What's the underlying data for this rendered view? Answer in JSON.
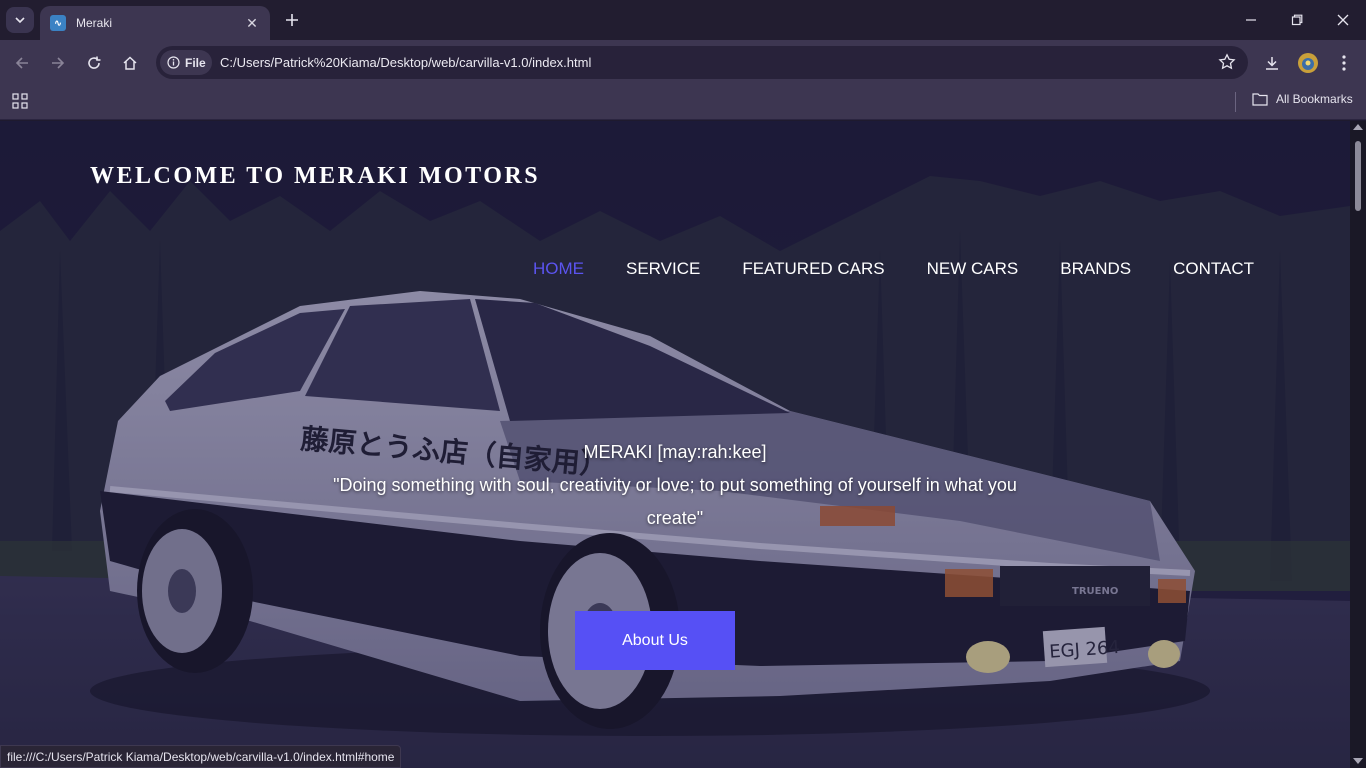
{
  "browser": {
    "tab_title": "Meraki",
    "url_chip": "File",
    "url": "C:/Users/Patrick%20Kiama/Desktop/web/carvilla-v1.0/index.html",
    "bookmarks_label": "All Bookmarks",
    "status_url": "file:///C:/Users/Patrick Kiama/Desktop/web/carvilla-v1.0/index.html#home"
  },
  "page": {
    "brand": "WELCOME TO MERAKI MOTORS",
    "nav": [
      {
        "label": "HOME",
        "active": true
      },
      {
        "label": "SERVICE",
        "active": false
      },
      {
        "label": "FEATURED CARS",
        "active": false
      },
      {
        "label": "NEW CARS",
        "active": false
      },
      {
        "label": "BRANDS",
        "active": false
      },
      {
        "label": "CONTACT",
        "active": false
      }
    ],
    "tagline_line1": "MERAKI [may:rah:kee]",
    "tagline_line2": "\"Doing something with soul, creativity or love; to put something of yourself in what you create\"",
    "button": "About Us",
    "car_decal": "藤原とうふ店（自家用）",
    "car_plate": "EGJ 264",
    "car_badge": "TRUENO"
  },
  "colors": {
    "accent": "#5650f5",
    "nav_active": "#5b54f0",
    "chrome": "#3d3651"
  }
}
